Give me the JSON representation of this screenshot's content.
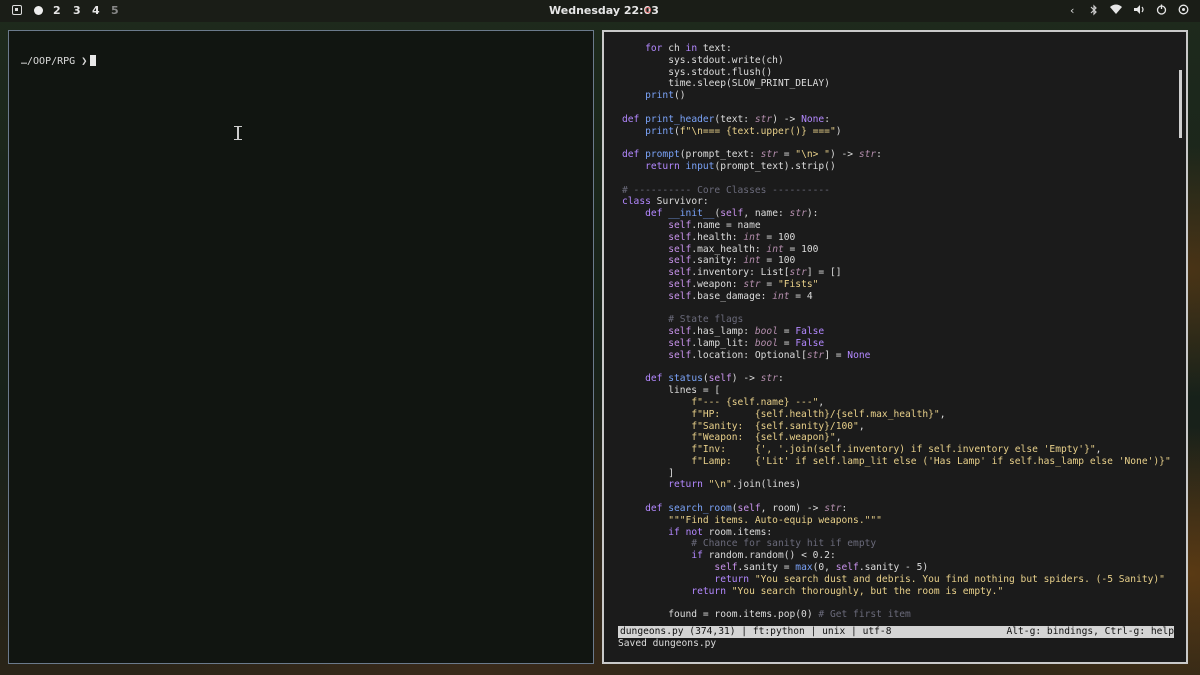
{
  "topbar": {
    "workspaces": [
      "2",
      "3",
      "4",
      "5"
    ],
    "clock": "Wednesday 22:03",
    "tray_icons": [
      "chevron-left-icon",
      "bluetooth-icon",
      "wifi-icon",
      "volume-icon",
      "power-icon",
      "settings-icon"
    ]
  },
  "left_terminal": {
    "prompt": "…/OOP/RPG ❯"
  },
  "editor": {
    "code_lines": [
      [
        [
          "    ",
          ""
        ],
        [
          "for",
          "kw"
        ],
        [
          " ch ",
          ""
        ],
        [
          "in",
          "kw"
        ],
        [
          " text:",
          ""
        ]
      ],
      [
        [
          "        sys.stdout.write(ch)",
          ""
        ]
      ],
      [
        [
          "        sys.stdout.flush()",
          ""
        ]
      ],
      [
        [
          "        time.sleep(SLOW_PRINT_DELAY)",
          ""
        ]
      ],
      [
        [
          "    ",
          ""
        ],
        [
          "print",
          "fn"
        ],
        [
          "()",
          ""
        ]
      ],
      [
        [
          "",
          ""
        ]
      ],
      [
        [
          "def",
          "kw"
        ],
        [
          " ",
          ""
        ],
        [
          "print_header",
          "fn"
        ],
        [
          "(text: ",
          ""
        ],
        [
          "str",
          "ty"
        ],
        [
          ") -> ",
          ""
        ],
        [
          "None",
          "kw"
        ],
        [
          ":",
          ""
        ]
      ],
      [
        [
          "    ",
          ""
        ],
        [
          "print",
          "fn"
        ],
        [
          "(",
          ""
        ],
        [
          "f\"\\n=== {text.upper()} ===\"",
          "st"
        ],
        [
          ")",
          ""
        ]
      ],
      [
        [
          "",
          ""
        ]
      ],
      [
        [
          "def",
          "kw"
        ],
        [
          " ",
          ""
        ],
        [
          "prompt",
          "fn"
        ],
        [
          "(prompt_text: ",
          ""
        ],
        [
          "str",
          "ty"
        ],
        [
          " = ",
          ""
        ],
        [
          "\"\\n> \"",
          "st"
        ],
        [
          ") -> ",
          ""
        ],
        [
          "str",
          "ty"
        ],
        [
          ":",
          ""
        ]
      ],
      [
        [
          "    ",
          ""
        ],
        [
          "return",
          "kw"
        ],
        [
          " ",
          ""
        ],
        [
          "input",
          "fn"
        ],
        [
          "(prompt_text).strip()",
          ""
        ]
      ],
      [
        [
          "",
          ""
        ]
      ],
      [
        [
          "# ---------- Core Classes ----------",
          "cm"
        ]
      ],
      [
        [
          "class",
          "kw"
        ],
        [
          " Survivor:",
          ""
        ]
      ],
      [
        [
          "    ",
          ""
        ],
        [
          "def",
          "kw"
        ],
        [
          " ",
          ""
        ],
        [
          "__init__",
          "fn"
        ],
        [
          "(",
          ""
        ],
        [
          "self",
          "sf"
        ],
        [
          ", name: ",
          ""
        ],
        [
          "str",
          "ty"
        ],
        [
          "):",
          ""
        ]
      ],
      [
        [
          "        ",
          ""
        ],
        [
          "self",
          "sf"
        ],
        [
          ".name = name",
          ""
        ]
      ],
      [
        [
          "        ",
          ""
        ],
        [
          "self",
          "sf"
        ],
        [
          ".health: ",
          ""
        ],
        [
          "int",
          "ty"
        ],
        [
          " = 100",
          ""
        ]
      ],
      [
        [
          "        ",
          ""
        ],
        [
          "self",
          "sf"
        ],
        [
          ".max_health: ",
          ""
        ],
        [
          "int",
          "ty"
        ],
        [
          " = 100",
          ""
        ]
      ],
      [
        [
          "        ",
          ""
        ],
        [
          "self",
          "sf"
        ],
        [
          ".sanity: ",
          ""
        ],
        [
          "int",
          "ty"
        ],
        [
          " = 100",
          ""
        ]
      ],
      [
        [
          "        ",
          ""
        ],
        [
          "self",
          "sf"
        ],
        [
          ".inventory: List[",
          ""
        ],
        [
          "str",
          "ty"
        ],
        [
          "] = []",
          ""
        ]
      ],
      [
        [
          "        ",
          ""
        ],
        [
          "self",
          "sf"
        ],
        [
          ".weapon: ",
          ""
        ],
        [
          "str",
          "ty"
        ],
        [
          " = ",
          ""
        ],
        [
          "\"Fists\"",
          "st"
        ]
      ],
      [
        [
          "        ",
          ""
        ],
        [
          "self",
          "sf"
        ],
        [
          ".base_damage: ",
          ""
        ],
        [
          "int",
          "ty"
        ],
        [
          " = 4",
          ""
        ]
      ],
      [
        [
          "",
          ""
        ]
      ],
      [
        [
          "        # State flags",
          "cm"
        ]
      ],
      [
        [
          "        ",
          ""
        ],
        [
          "self",
          "sf"
        ],
        [
          ".has_lamp: ",
          ""
        ],
        [
          "bool",
          "ty"
        ],
        [
          " = ",
          ""
        ],
        [
          "False",
          "kw"
        ]
      ],
      [
        [
          "        ",
          ""
        ],
        [
          "self",
          "sf"
        ],
        [
          ".lamp_lit: ",
          ""
        ],
        [
          "bool",
          "ty"
        ],
        [
          " = ",
          ""
        ],
        [
          "False",
          "kw"
        ]
      ],
      [
        [
          "        ",
          ""
        ],
        [
          "self",
          "sf"
        ],
        [
          ".location: Optional[",
          ""
        ],
        [
          "str",
          "ty"
        ],
        [
          "] = ",
          ""
        ],
        [
          "None",
          "kw"
        ]
      ],
      [
        [
          "",
          ""
        ]
      ],
      [
        [
          "    ",
          ""
        ],
        [
          "def",
          "kw"
        ],
        [
          " ",
          ""
        ],
        [
          "status",
          "fn"
        ],
        [
          "(",
          ""
        ],
        [
          "self",
          "sf"
        ],
        [
          ") -> ",
          ""
        ],
        [
          "str",
          "ty"
        ],
        [
          ":",
          ""
        ]
      ],
      [
        [
          "        lines = [",
          ""
        ]
      ],
      [
        [
          "            ",
          ""
        ],
        [
          "f\"--- {self.name} ---\"",
          "st"
        ],
        [
          ",",
          ""
        ]
      ],
      [
        [
          "            ",
          ""
        ],
        [
          "f\"HP:      {self.health}/{self.max_health}\"",
          "st"
        ],
        [
          ",",
          ""
        ]
      ],
      [
        [
          "            ",
          ""
        ],
        [
          "f\"Sanity:  {self.sanity}/100\"",
          "st"
        ],
        [
          ",",
          ""
        ]
      ],
      [
        [
          "            ",
          ""
        ],
        [
          "f\"Weapon:  {self.weapon}\"",
          "st"
        ],
        [
          ",",
          ""
        ]
      ],
      [
        [
          "            ",
          ""
        ],
        [
          "f\"Inv:     {', '.join(self.inventory) if self.inventory else 'Empty'}\"",
          "st"
        ],
        [
          ",",
          ""
        ]
      ],
      [
        [
          "            ",
          ""
        ],
        [
          "f\"Lamp:    {'Lit' if self.lamp_lit else ('Has Lamp' if self.has_lamp else 'None')}\"",
          "st"
        ]
      ],
      [
        [
          "        ]",
          ""
        ]
      ],
      [
        [
          "        ",
          ""
        ],
        [
          "return",
          "kw"
        ],
        [
          " ",
          ""
        ],
        [
          "\"\\n\"",
          "st"
        ],
        [
          ".join(lines)",
          ""
        ]
      ],
      [
        [
          "",
          ""
        ]
      ],
      [
        [
          "    ",
          ""
        ],
        [
          "def",
          "kw"
        ],
        [
          " ",
          ""
        ],
        [
          "search_room",
          "fn"
        ],
        [
          "(",
          ""
        ],
        [
          "self",
          "sf"
        ],
        [
          ", room) -> ",
          ""
        ],
        [
          "str",
          "ty"
        ],
        [
          ":",
          ""
        ]
      ],
      [
        [
          "        ",
          ""
        ],
        [
          "\"\"\"Find items. Auto-equip weapons.\"\"\"",
          "st"
        ]
      ],
      [
        [
          "        ",
          ""
        ],
        [
          "if",
          "kw"
        ],
        [
          " ",
          ""
        ],
        [
          "not",
          "kw"
        ],
        [
          " room.items:",
          ""
        ]
      ],
      [
        [
          "            # Chance for sanity hit if empty",
          "cm"
        ]
      ],
      [
        [
          "            ",
          ""
        ],
        [
          "if",
          "kw"
        ],
        [
          " random.random() < 0.2:",
          ""
        ]
      ],
      [
        [
          "                ",
          ""
        ],
        [
          "self",
          "sf"
        ],
        [
          ".sanity = ",
          ""
        ],
        [
          "max",
          "fn"
        ],
        [
          "(0, ",
          ""
        ],
        [
          "self",
          "sf"
        ],
        [
          ".sanity - 5)",
          ""
        ]
      ],
      [
        [
          "                ",
          ""
        ],
        [
          "return",
          "kw"
        ],
        [
          " ",
          ""
        ],
        [
          "\"You search dust and debris. You find nothing but spiders. (-5 Sanity)\"",
          "st"
        ]
      ],
      [
        [
          "            ",
          ""
        ],
        [
          "return",
          "kw"
        ],
        [
          " ",
          ""
        ],
        [
          "\"You search thoroughly, but the room is empty.\"",
          "st"
        ]
      ],
      [
        [
          "",
          ""
        ]
      ],
      [
        [
          "        found = room.items.pop(0) ",
          ""
        ],
        [
          "# Get first item",
          "cm"
        ]
      ]
    ],
    "status_left": "dungeons.py (374,31) | ft:python | unix | utf-8",
    "status_right": "Alt-g: bindings, Ctrl-g: help",
    "message": "Saved dungeons.py"
  }
}
